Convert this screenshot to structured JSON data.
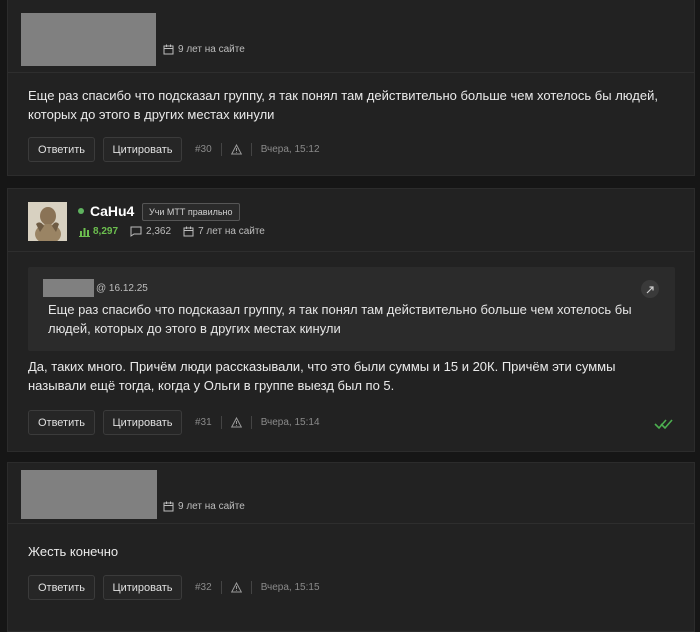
{
  "posts": [
    {
      "member_since": "9 лет на сайте",
      "text": "Еще раз спасибо что подсказал группу, я так понял там действительно больше чем хотелось бы людей, которых до этого в других местах кинули",
      "reply_label": "Ответить",
      "quote_label": "Цитировать",
      "number": "#30",
      "time": "Вчера, 15:12"
    },
    {
      "author": {
        "name": "CaHu4",
        "badge": "Учи МТТ правильно",
        "rating": "8,297",
        "messages": "2,362",
        "member_since": "7 лет на сайте"
      },
      "quote": {
        "date": "@ 16.12.25",
        "text": "Еще раз спасибо что подсказал группу, я так понял там действительно больше чем хотелось бы людей, которых до этого в других местах кинули"
      },
      "text": "Да, таких много. Причём люди рассказывали, что это были суммы и 15 и 20К. Причём эти суммы называли ещё тогда, когда у Ольги в группе выезд был по 5.",
      "reply_label": "Ответить",
      "quote_label": "Цитировать",
      "number": "#31",
      "time": "Вчера, 15:14"
    },
    {
      "member_since": "9 лет на сайте",
      "text": "Жесть конечно",
      "reply_label": "Ответить",
      "quote_label": "Цитировать",
      "number": "#32",
      "time": "Вчера, 15:15"
    }
  ],
  "colors": {
    "background": "#161616",
    "card": "#222222",
    "rating_green": "#6cbf4f",
    "online_green": "#5fb35f"
  },
  "icons": [
    "calendar-icon",
    "warning-icon",
    "rating-icon",
    "messages-icon",
    "double-check-icon",
    "quote-link-icon"
  ]
}
